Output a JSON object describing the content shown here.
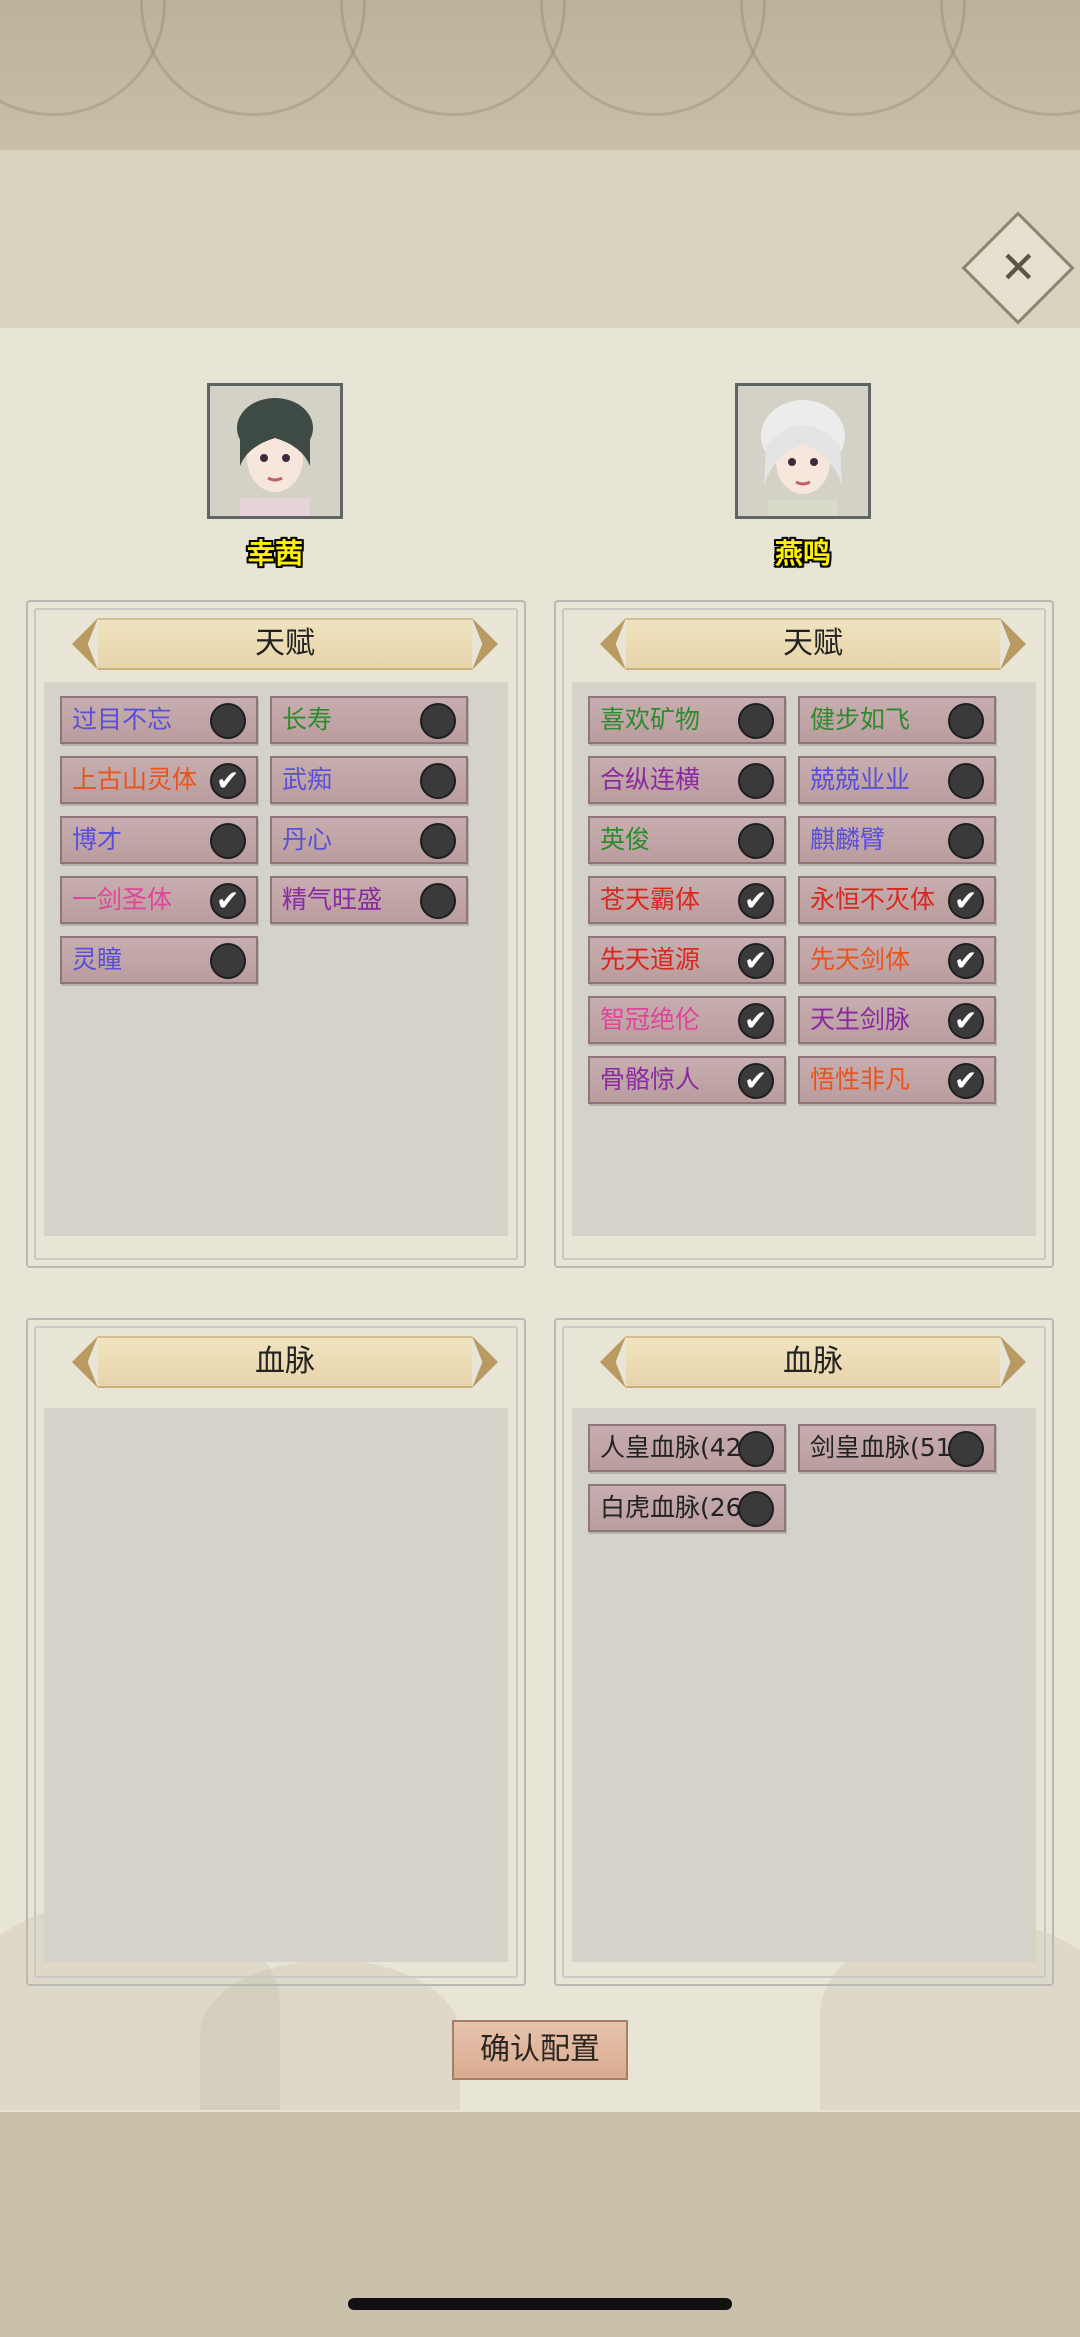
{
  "header": {
    "close_icon": "close-icon"
  },
  "characters": [
    {
      "name": "幸茜"
    },
    {
      "name": "燕鸣"
    }
  ],
  "left_talents": {
    "title": "天赋",
    "items": [
      {
        "label": "过目不忘",
        "color": "#5a4fd8",
        "checked": false
      },
      {
        "label": "长寿",
        "color": "#2e8a2e",
        "checked": false
      },
      {
        "label": "上古山灵体",
        "color": "#e8541e",
        "checked": true
      },
      {
        "label": "武痴",
        "color": "#5a4fd8",
        "checked": false
      },
      {
        "label": "博才",
        "color": "#5a4fd8",
        "checked": false
      },
      {
        "label": "丹心",
        "color": "#5a4fd8",
        "checked": false
      },
      {
        "label": "一剑圣体",
        "color": "#e0459a",
        "checked": true
      },
      {
        "label": "精气旺盛",
        "color": "#8a2aa0",
        "checked": false
      },
      {
        "label": "灵瞳",
        "color": "#5a4fd8",
        "checked": false
      }
    ]
  },
  "right_talents": {
    "title": "天赋",
    "items": [
      {
        "label": "喜欢矿物",
        "color": "#2e8a2e",
        "checked": false
      },
      {
        "label": "健步如飞",
        "color": "#2e8a2e",
        "checked": false
      },
      {
        "label": "合纵连横",
        "color": "#8a2aa0",
        "checked": false
      },
      {
        "label": "兢兢业业",
        "color": "#5a4fd8",
        "checked": false
      },
      {
        "label": "英俊",
        "color": "#2e8a2e",
        "checked": false
      },
      {
        "label": "麒麟臂",
        "color": "#5a4fd8",
        "checked": false
      },
      {
        "label": "苍天霸体",
        "color": "#d8281e",
        "checked": true
      },
      {
        "label": "永恒不灭体",
        "color": "#d8281e",
        "checked": true
      },
      {
        "label": "先天道源",
        "color": "#d8281e",
        "checked": true
      },
      {
        "label": "先天剑体",
        "color": "#e8541e",
        "checked": true
      },
      {
        "label": "智冠绝伦",
        "color": "#e0459a",
        "checked": true
      },
      {
        "label": "天生剑脉",
        "color": "#8a2aa0",
        "checked": true
      },
      {
        "label": "骨骼惊人",
        "color": "#8a2aa0",
        "checked": true
      },
      {
        "label": "悟性非凡",
        "color": "#e8541e",
        "checked": true
      }
    ]
  },
  "left_bloodline": {
    "title": "血脉",
    "items": []
  },
  "right_bloodline": {
    "title": "血脉",
    "items": [
      {
        "label": "人皇血脉(42)",
        "color": "#222222",
        "checked": false
      },
      {
        "label": "剑皇血脉(51)",
        "color": "#222222",
        "checked": false
      },
      {
        "label": "白虎血脉(26)",
        "color": "#222222",
        "checked": false
      }
    ]
  },
  "footer": {
    "confirm_label": "确认配置"
  }
}
